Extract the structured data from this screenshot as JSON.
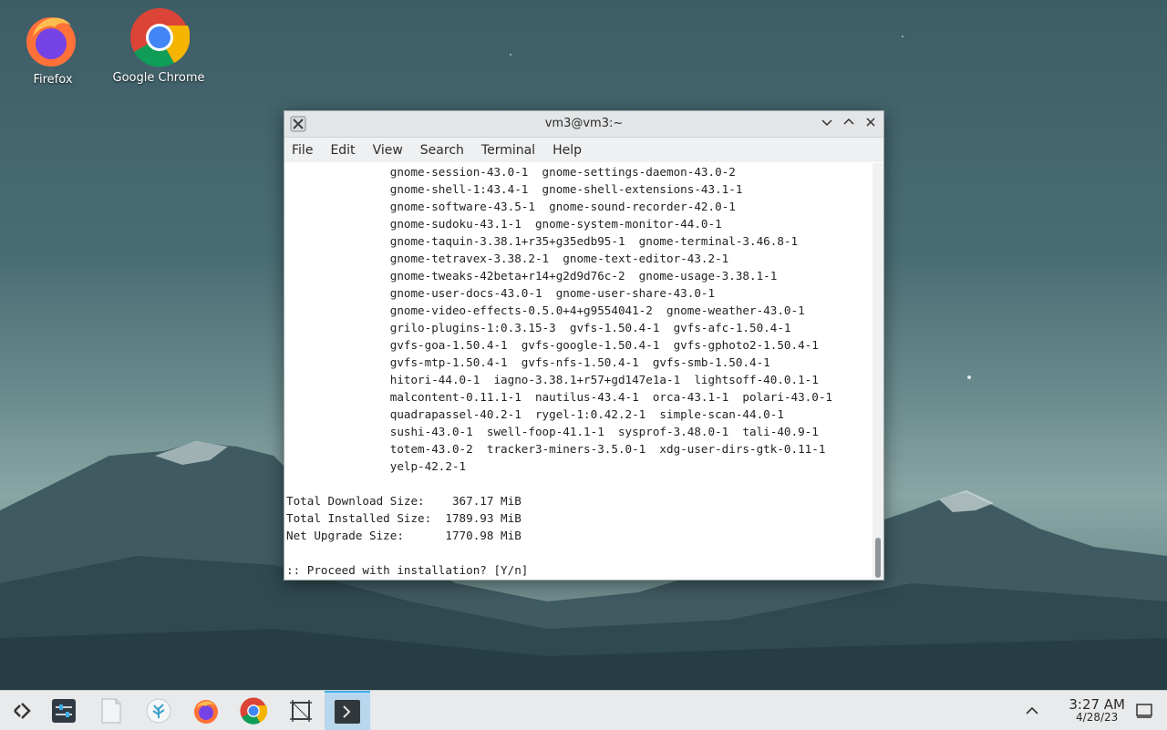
{
  "desktop": {
    "icons": [
      {
        "label": "Firefox"
      },
      {
        "label": "Google Chrome"
      }
    ]
  },
  "window": {
    "title": "vm3@vm3:~",
    "menu": [
      "File",
      "Edit",
      "View",
      "Search",
      "Terminal",
      "Help"
    ],
    "lines": [
      "               gnome-session-43.0-1  gnome-settings-daemon-43.0-2",
      "               gnome-shell-1:43.4-1  gnome-shell-extensions-43.1-1",
      "               gnome-software-43.5-1  gnome-sound-recorder-42.0-1",
      "               gnome-sudoku-43.1-1  gnome-system-monitor-44.0-1",
      "               gnome-taquin-3.38.1+r35+g35edb95-1  gnome-terminal-3.46.8-1",
      "               gnome-tetravex-3.38.2-1  gnome-text-editor-43.2-1",
      "               gnome-tweaks-42beta+r14+g2d9d76c-2  gnome-usage-3.38.1-1",
      "               gnome-user-docs-43.0-1  gnome-user-share-43.0-1",
      "               gnome-video-effects-0.5.0+4+g9554041-2  gnome-weather-43.0-1",
      "               grilo-plugins-1:0.3.15-3  gvfs-1.50.4-1  gvfs-afc-1.50.4-1",
      "               gvfs-goa-1.50.4-1  gvfs-google-1.50.4-1  gvfs-gphoto2-1.50.4-1",
      "               gvfs-mtp-1.50.4-1  gvfs-nfs-1.50.4-1  gvfs-smb-1.50.4-1",
      "               hitori-44.0-1  iagno-3.38.1+r57+gd147e1a-1  lightsoff-40.0.1-1",
      "               malcontent-0.11.1-1  nautilus-43.4-1  orca-43.1-1  polari-43.0-1",
      "               quadrapassel-40.2-1  rygel-1:0.42.2-1  simple-scan-44.0-1",
      "               sushi-43.0-1  swell-foop-41.1-1  sysprof-3.48.0-1  tali-40.9-1",
      "               totem-43.0-2  tracker3-miners-3.5.0-1  xdg-user-dirs-gtk-0.11-1",
      "               yelp-42.2-1",
      "",
      "Total Download Size:    367.17 MiB",
      "Total Installed Size:  1789.93 MiB",
      "Net Upgrade Size:      1770.98 MiB",
      "",
      ":: Proceed with installation? [Y/n]"
    ]
  },
  "taskbar": {
    "clock_time": "3:27 AM",
    "clock_date": "4/28/23",
    "items": [
      "app-launcher-icon",
      "system-settings-icon",
      "file-manager-icon",
      "discover-icon",
      "firefox-icon",
      "chrome-icon",
      "screenshot-icon",
      "terminal-icon"
    ]
  },
  "colors": {
    "accent": "#3daee9",
    "taskbar_bg": "#e8eaeb"
  }
}
